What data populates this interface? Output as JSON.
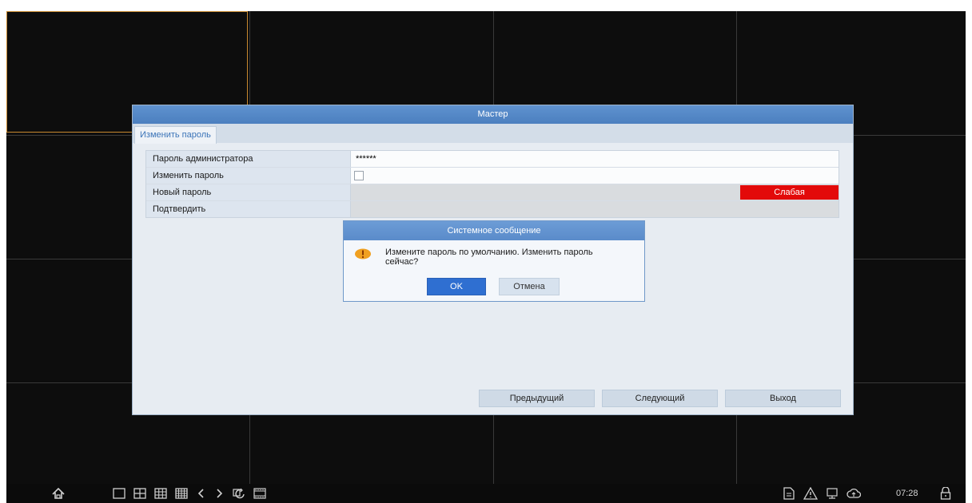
{
  "wizard": {
    "title": "Мастер",
    "tab": "Изменить пароль",
    "fields": [
      {
        "label": "Пароль администратора",
        "value": "******"
      },
      {
        "label": "Изменить пароль",
        "checked": false
      },
      {
        "label": "Новый пароль",
        "strength": "Слабая"
      },
      {
        "label": "Подтвердить",
        "value": ""
      }
    ],
    "buttons": {
      "prev": "Предыдущий",
      "next": "Следующий",
      "exit": "Выход"
    }
  },
  "message": {
    "title": "Системное сообщение",
    "text": "Измените пароль по умолчанию. Изменить пароль сейчас?",
    "ok": "OK",
    "cancel": "Отмена"
  },
  "taskbar": {
    "time": "07:28",
    "left_icons": [
      "home-icon",
      "layout-1-icon",
      "layout-4-icon",
      "layout-9-icon",
      "layout-16-icon",
      "prev-page-icon",
      "next-page-icon",
      "sequence-icon",
      "playback-icon"
    ],
    "right_icons": [
      "log-icon",
      "alarm-icon",
      "network-icon",
      "cloud-icon",
      "lock-icon"
    ]
  },
  "colors": {
    "accent": "#4b7fbf",
    "weak": "#e30a0a",
    "selected_cell": "#c8892f"
  }
}
